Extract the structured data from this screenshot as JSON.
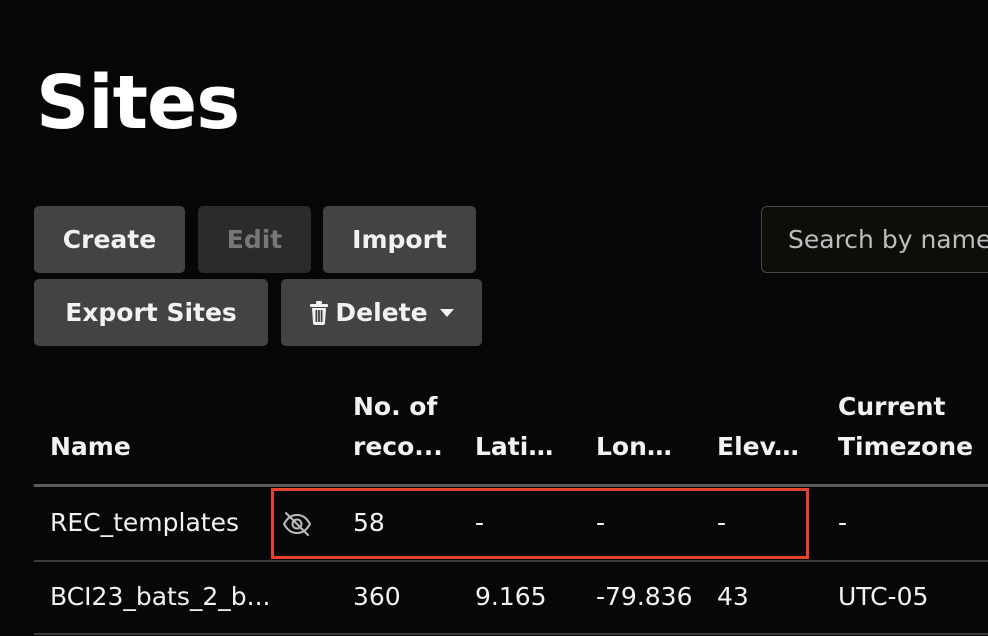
{
  "page": {
    "title": "Sites"
  },
  "toolbar": {
    "create_label": "Create",
    "edit_label": "Edit",
    "import_label": "Import",
    "export_label": "Export Sites",
    "delete_label": "Delete",
    "icons": {
      "delete": "trash-icon",
      "delete_menu": "caret-down-icon"
    }
  },
  "search": {
    "placeholder": "Search by name"
  },
  "table": {
    "columns": {
      "name": "Name",
      "recordings_line1": "No. of",
      "recordings_line2": "reco...",
      "latitude": "Latit...",
      "longitude": "Long...",
      "elevation": "Elev...",
      "timezone_line1": "Current",
      "timezone_line2": "Timezone"
    },
    "rows": [
      {
        "name": "REC_templates",
        "icon": "eye-slash-icon",
        "recordings": "58",
        "latitude": "-",
        "longitude": "-",
        "elevation": "-",
        "timezone": "-"
      },
      {
        "name": "BCI23_bats_2_b...",
        "recordings": "360",
        "latitude": "9.165",
        "longitude": "-79.836",
        "elevation": "43",
        "timezone": "UTC-05"
      }
    ]
  },
  "colors": {
    "background": "#070709",
    "button": "#434343",
    "button_disabled": "#2b2b2b",
    "highlight": "#e8432e"
  }
}
